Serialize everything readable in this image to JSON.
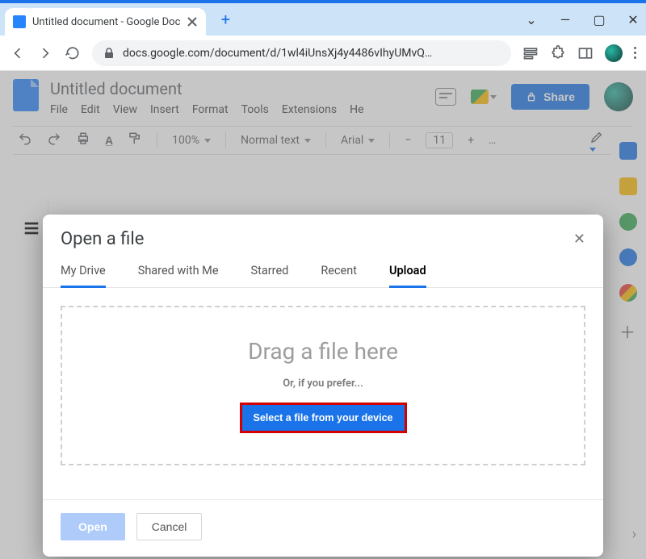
{
  "browser": {
    "tab_title": "Untitled document - Google Doc",
    "url": "docs.google.com/document/d/1wl4iUnsXj4y4486vIhyUMvQ…",
    "new_tab_label": "+"
  },
  "docs": {
    "doc_title": "Untitled document",
    "menus": [
      "File",
      "Edit",
      "View",
      "Insert",
      "Format",
      "Tools",
      "Extensions",
      "He"
    ],
    "share_label": "Share",
    "toolbar": {
      "zoom": "100%",
      "style": "Normal text",
      "font": "Arial",
      "size": "11",
      "overflow": "…"
    }
  },
  "dialog": {
    "title": "Open a file",
    "tabs": [
      {
        "label": "My Drive",
        "active_underline": true
      },
      {
        "label": "Shared with Me"
      },
      {
        "label": "Starred"
      },
      {
        "label": "Recent"
      },
      {
        "label": "Upload",
        "selected": true
      }
    ],
    "drag_text": "Drag a file here",
    "prefer_text": "Or, if you prefer...",
    "select_button": "Select a file from your device",
    "open_button": "Open",
    "cancel_button": "Cancel",
    "close_label": "✕"
  }
}
